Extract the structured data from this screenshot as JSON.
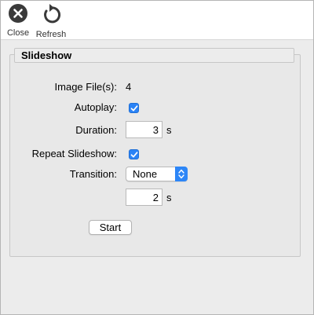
{
  "toolbar": {
    "close_label": "Close",
    "refresh_label": "Refresh"
  },
  "slideshow": {
    "title": "Slideshow",
    "image_files_label": "Image File(s):",
    "image_files_value": "4",
    "autoplay_label": "Autoplay:",
    "autoplay_checked": true,
    "duration_label": "Duration:",
    "duration_value": "3",
    "duration_unit": "s",
    "repeat_label": "Repeat Slideshow:",
    "repeat_checked": true,
    "transition_label": "Transition:",
    "transition_value": "None",
    "transition_duration_value": "2",
    "transition_duration_unit": "s",
    "start_label": "Start"
  },
  "colors": {
    "accent": "#2a83f6",
    "toolbar_bg": "#ffffff",
    "window_bg": "#ececec"
  }
}
